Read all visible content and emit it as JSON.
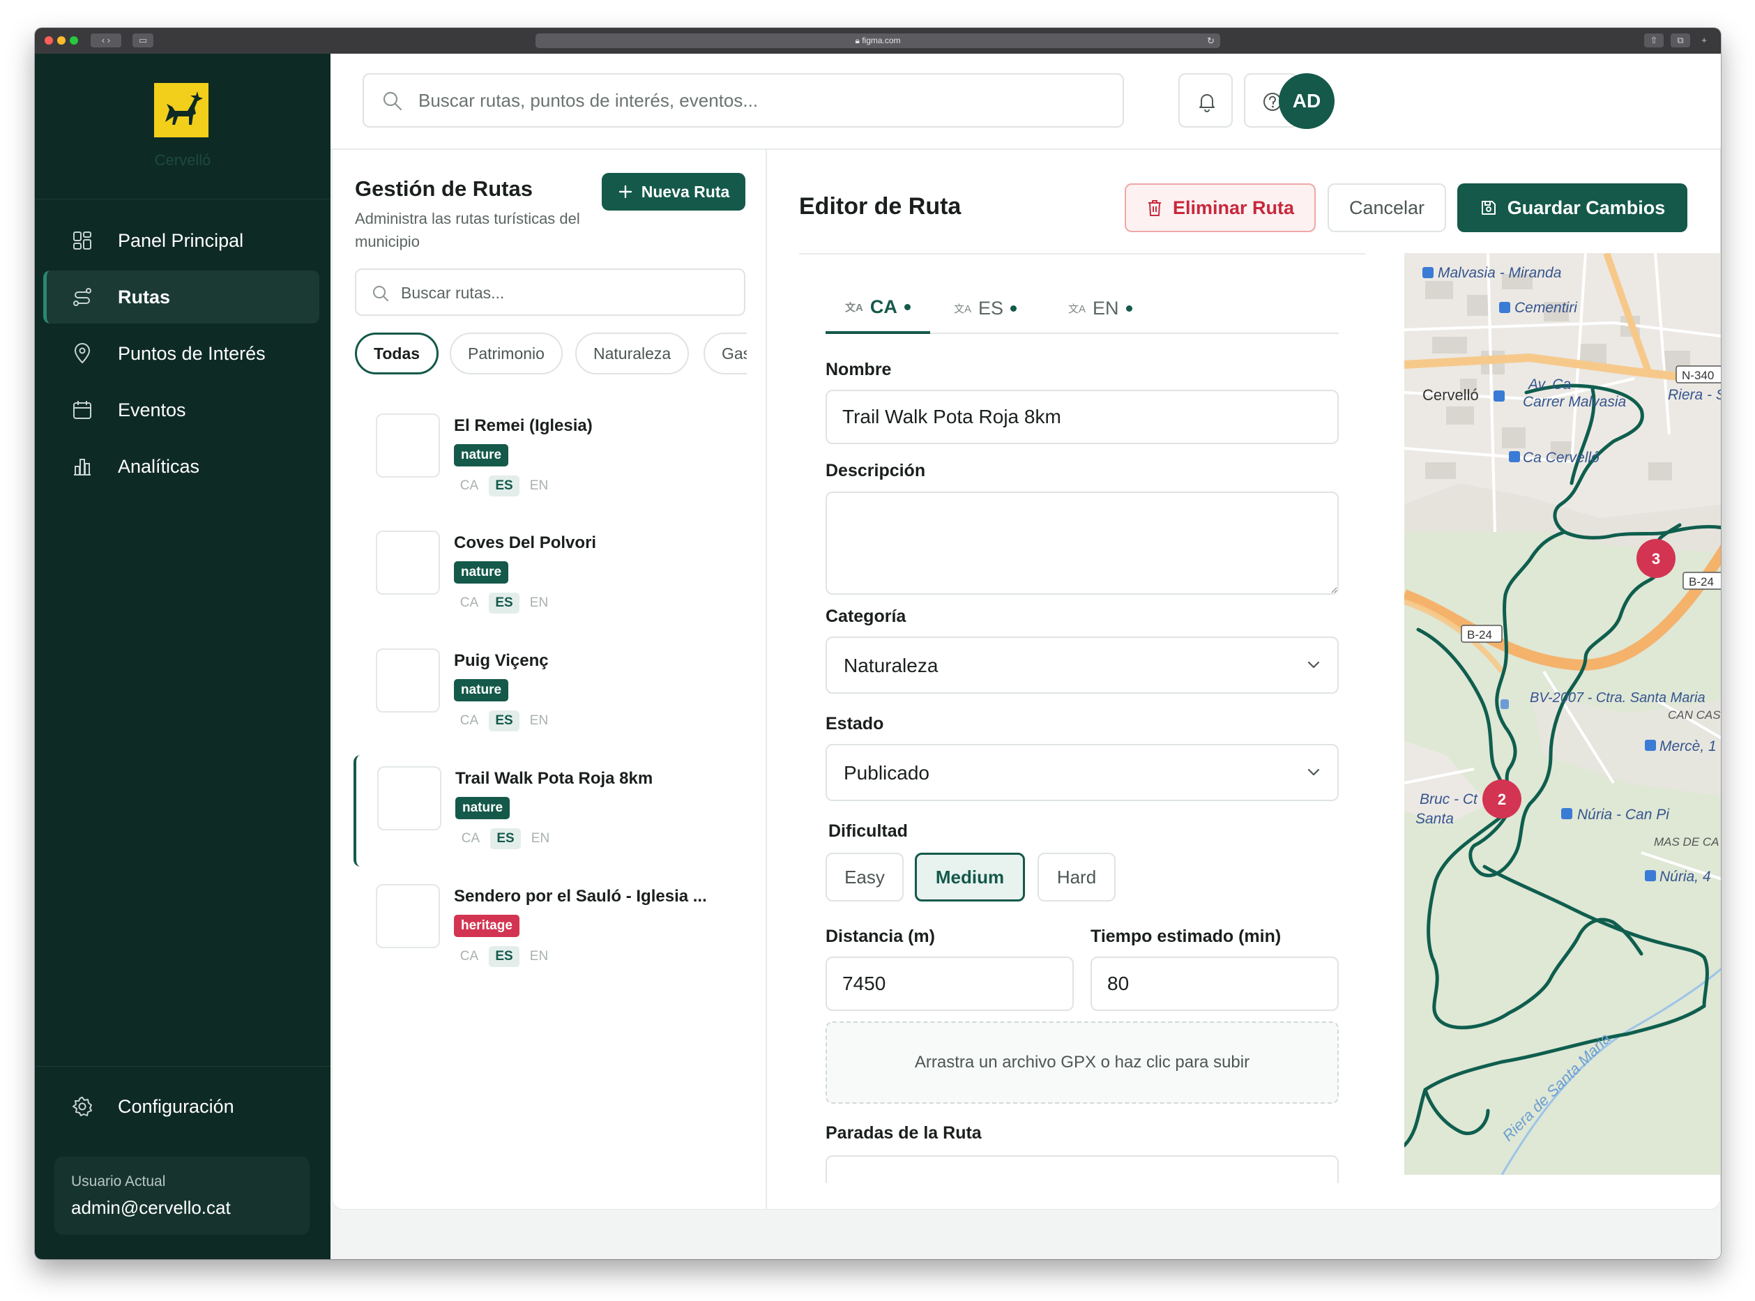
{
  "browser": {
    "url": "figma.com"
  },
  "brand": {
    "name": "Cervelló",
    "logo_bg": "#f2cf1a"
  },
  "sidebar": {
    "items": [
      {
        "label": "Panel Principal",
        "icon": "dashboard-icon"
      },
      {
        "label": "Rutas",
        "icon": "route-icon",
        "active": true
      },
      {
        "label": "Puntos de Interés",
        "icon": "map-pin-icon"
      },
      {
        "label": "Eventos",
        "icon": "calendar-icon"
      },
      {
        "label": "Analíticas",
        "icon": "bar-chart-icon"
      }
    ],
    "settings_label": "Configuración",
    "user_caption": "Usuario Actual",
    "user_email": "admin@cervello.cat"
  },
  "header": {
    "search_placeholder": "Buscar rutas, puntos de interés, eventos...",
    "avatar_initials": "AD"
  },
  "routes_panel": {
    "title": "Gestión de Rutas",
    "subtitle": "Administra las rutas turísticas del municipio",
    "new_button": "Nueva Ruta",
    "search_placeholder": "Buscar rutas...",
    "filters": [
      "Todas",
      "Patrimonio",
      "Naturaleza",
      "Gastronomía"
    ],
    "active_filter": "Todas",
    "lang_labels": [
      "CA",
      "ES",
      "EN"
    ],
    "routes": [
      {
        "name": "El Remei (Iglesia)",
        "tag": "nature",
        "langs_on": [
          "ES"
        ]
      },
      {
        "name": "Coves Del Polvori",
        "tag": "nature",
        "langs_on": [
          "ES"
        ]
      },
      {
        "name": "Puig Viçenç",
        "tag": "nature",
        "langs_on": [
          "ES"
        ]
      },
      {
        "name": "Trail Walk Pota Roja 8km",
        "tag": "nature",
        "langs_on": [
          "ES"
        ],
        "selected": true
      },
      {
        "name": "Sendero por el Sauló - Iglesia ...",
        "tag": "heritage",
        "langs_on": [
          "ES"
        ]
      }
    ]
  },
  "editor": {
    "title": "Editor de Ruta",
    "delete_label": "Eliminar Ruta",
    "cancel_label": "Cancelar",
    "save_label": "Guardar Cambios",
    "tabs": [
      {
        "label": "CA",
        "active": true
      },
      {
        "label": "ES"
      },
      {
        "label": "EN"
      }
    ],
    "name_label": "Nombre",
    "name_value": "Trail Walk Pota Roja 8km",
    "description_label": "Descripción",
    "description_value": "",
    "category_label": "Categoría",
    "category_value": "Naturaleza",
    "status_label": "Estado",
    "status_value": "Publicado",
    "difficulty_label": "Dificultad",
    "difficulty_options": [
      "Easy",
      "Medium",
      "Hard"
    ],
    "difficulty_selected": "Medium",
    "distance_label": "Distancia (m)",
    "distance_value": "7450",
    "time_label": "Tiempo estimado (min)",
    "time_value": "80",
    "upload_text": "Arrastra un archivo GPX o haz clic para subir",
    "stops_label": "Paradas de la Ruta"
  },
  "map": {
    "labels": [
      "Malvasia - Miranda",
      "Cementiri",
      "Cervelló",
      "N-340",
      "Carrer Malvasia",
      "Riera - Sa",
      "Av. Ca",
      "Ca Cervelló",
      "B-24",
      "B-24",
      "BV-2007 - Ctra. Santa Maria",
      "CAN CAS",
      "Mercè, 1",
      "Núria - Can Pi",
      "MAS DE CA",
      "Núria, 4",
      "Bruc - Ct",
      "Santa",
      "Riera de Santa Maria"
    ],
    "markers": [
      "2",
      "3"
    ],
    "route_color": "#0f5e4e",
    "marker_color": "#d33452"
  }
}
